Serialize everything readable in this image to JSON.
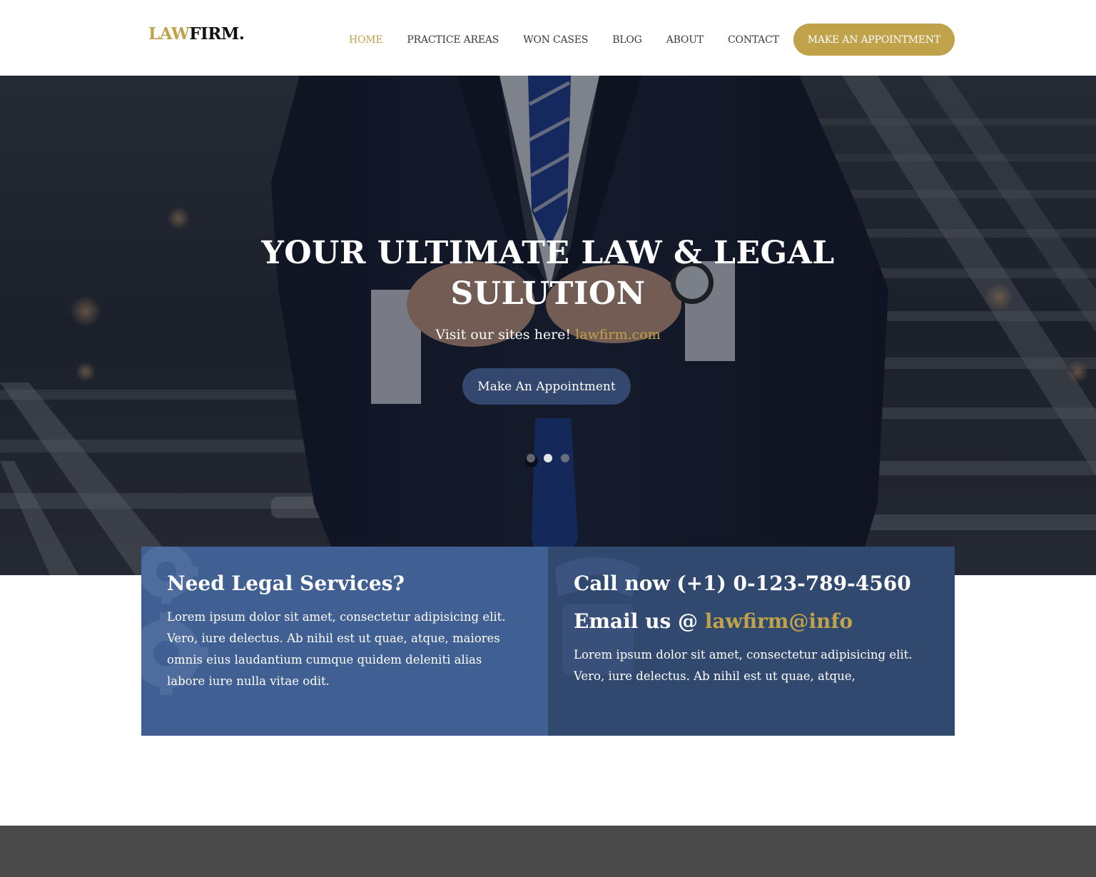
{
  "brand": {
    "logo_part1": "LAW",
    "logo_part2": "FIRM."
  },
  "nav": {
    "items": [
      {
        "label": "HOME",
        "active": true
      },
      {
        "label": "PRACTICE AREAS",
        "active": false
      },
      {
        "label": "WON CASES",
        "active": false
      },
      {
        "label": "BLOG",
        "active": false
      },
      {
        "label": "ABOUT",
        "active": false
      },
      {
        "label": "CONTACT",
        "active": false
      }
    ],
    "cta_label": "MAKE AN APPOINTMENT"
  },
  "hero": {
    "title_line1": "YOUR ULTIMATE LAW & LEGAL",
    "title_line2": "SULUTION",
    "subtitle_text": "Visit our sites here!",
    "subtitle_link": "lawfirm.com",
    "button_label": "Make An Appointment",
    "slides": {
      "count": 3,
      "active_index": 1
    }
  },
  "services": {
    "heading": "Need Legal Services?",
    "body": "Lorem ipsum dolor sit amet, consectetur adipisicing elit. Vero, iure delectus. Ab nihil est ut quae, atque, maiores omnis eius laudantium cumque quidem deleniti alias labore iure nulla vitae odit.",
    "icon": "gears-icon"
  },
  "contact": {
    "call_text": "Call now (+1) 0-123-789-4560",
    "email_prefix": "Email us @",
    "email_value": "lawfirm@info",
    "body": "Lorem ipsum dolor sit amet, consectetur adipisicing elit. Vero, iure delectus. Ab nihil est ut quae, atque,",
    "icon": "phone-icon"
  },
  "colors": {
    "accent_gold": "#bfa24a",
    "panel_left_blue": "#405f93",
    "panel_right_navy": "#32496f",
    "hero_button": "#34476f",
    "bottom_band": "#4a4a4a"
  }
}
